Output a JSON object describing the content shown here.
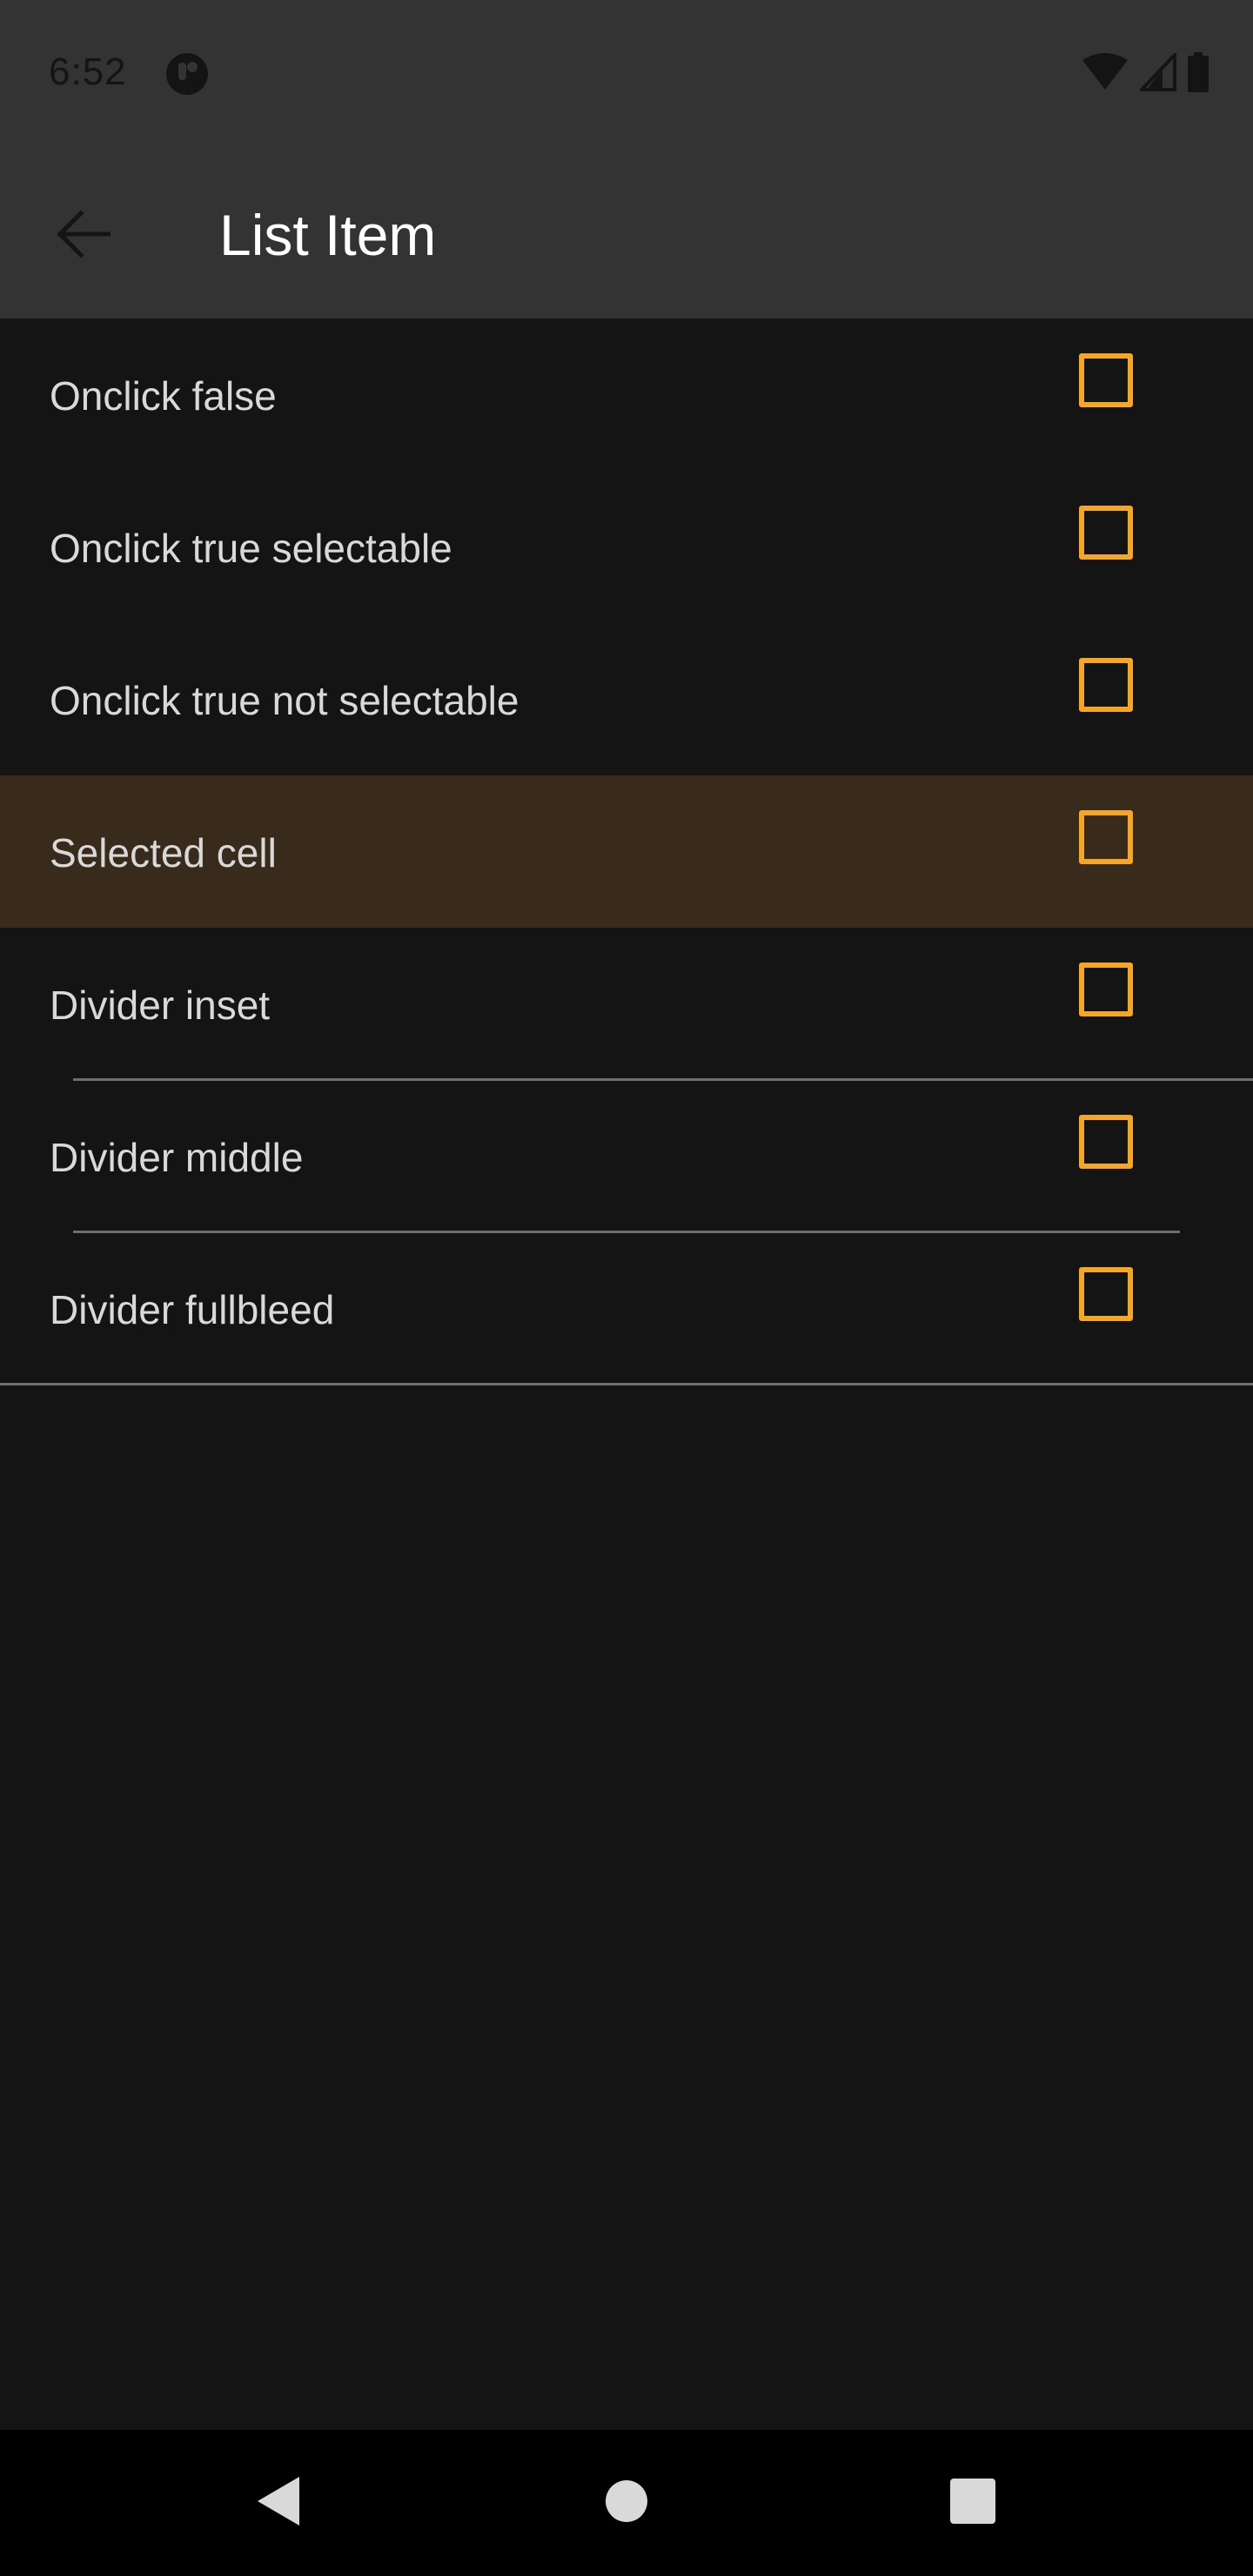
{
  "status_bar": {
    "time": "6:52",
    "icons": [
      "app-notification-icon",
      "wifi-icon",
      "signal-icon",
      "battery-icon"
    ]
  },
  "app_bar": {
    "title": "List Item",
    "back_icon": "arrow-back-icon"
  },
  "list": {
    "items": [
      {
        "label": "Onclick false",
        "checked": false,
        "selected": false,
        "divider": "none"
      },
      {
        "label": "Onclick true selectable",
        "checked": false,
        "selected": false,
        "divider": "none"
      },
      {
        "label": "Onclick true not selectable",
        "checked": false,
        "selected": false,
        "divider": "none"
      },
      {
        "label": "Selected cell",
        "checked": false,
        "selected": true,
        "divider": "none"
      },
      {
        "label": "Divider inset",
        "checked": false,
        "selected": false,
        "divider": "inset"
      },
      {
        "label": "Divider middle",
        "checked": false,
        "selected": false,
        "divider": "middle"
      },
      {
        "label": "Divider fullbleed",
        "checked": false,
        "selected": false,
        "divider": "fullbleed"
      }
    ]
  },
  "nav_bar": {
    "icons": [
      "nav-back-icon",
      "nav-home-icon",
      "nav-recents-icon"
    ]
  },
  "colors": {
    "background": "#141414",
    "app_bar": "#333333",
    "accent": "#f5a623",
    "selected_row": "#382b1b",
    "divider": "#6e6e6e",
    "text": "#d9d9d9"
  }
}
